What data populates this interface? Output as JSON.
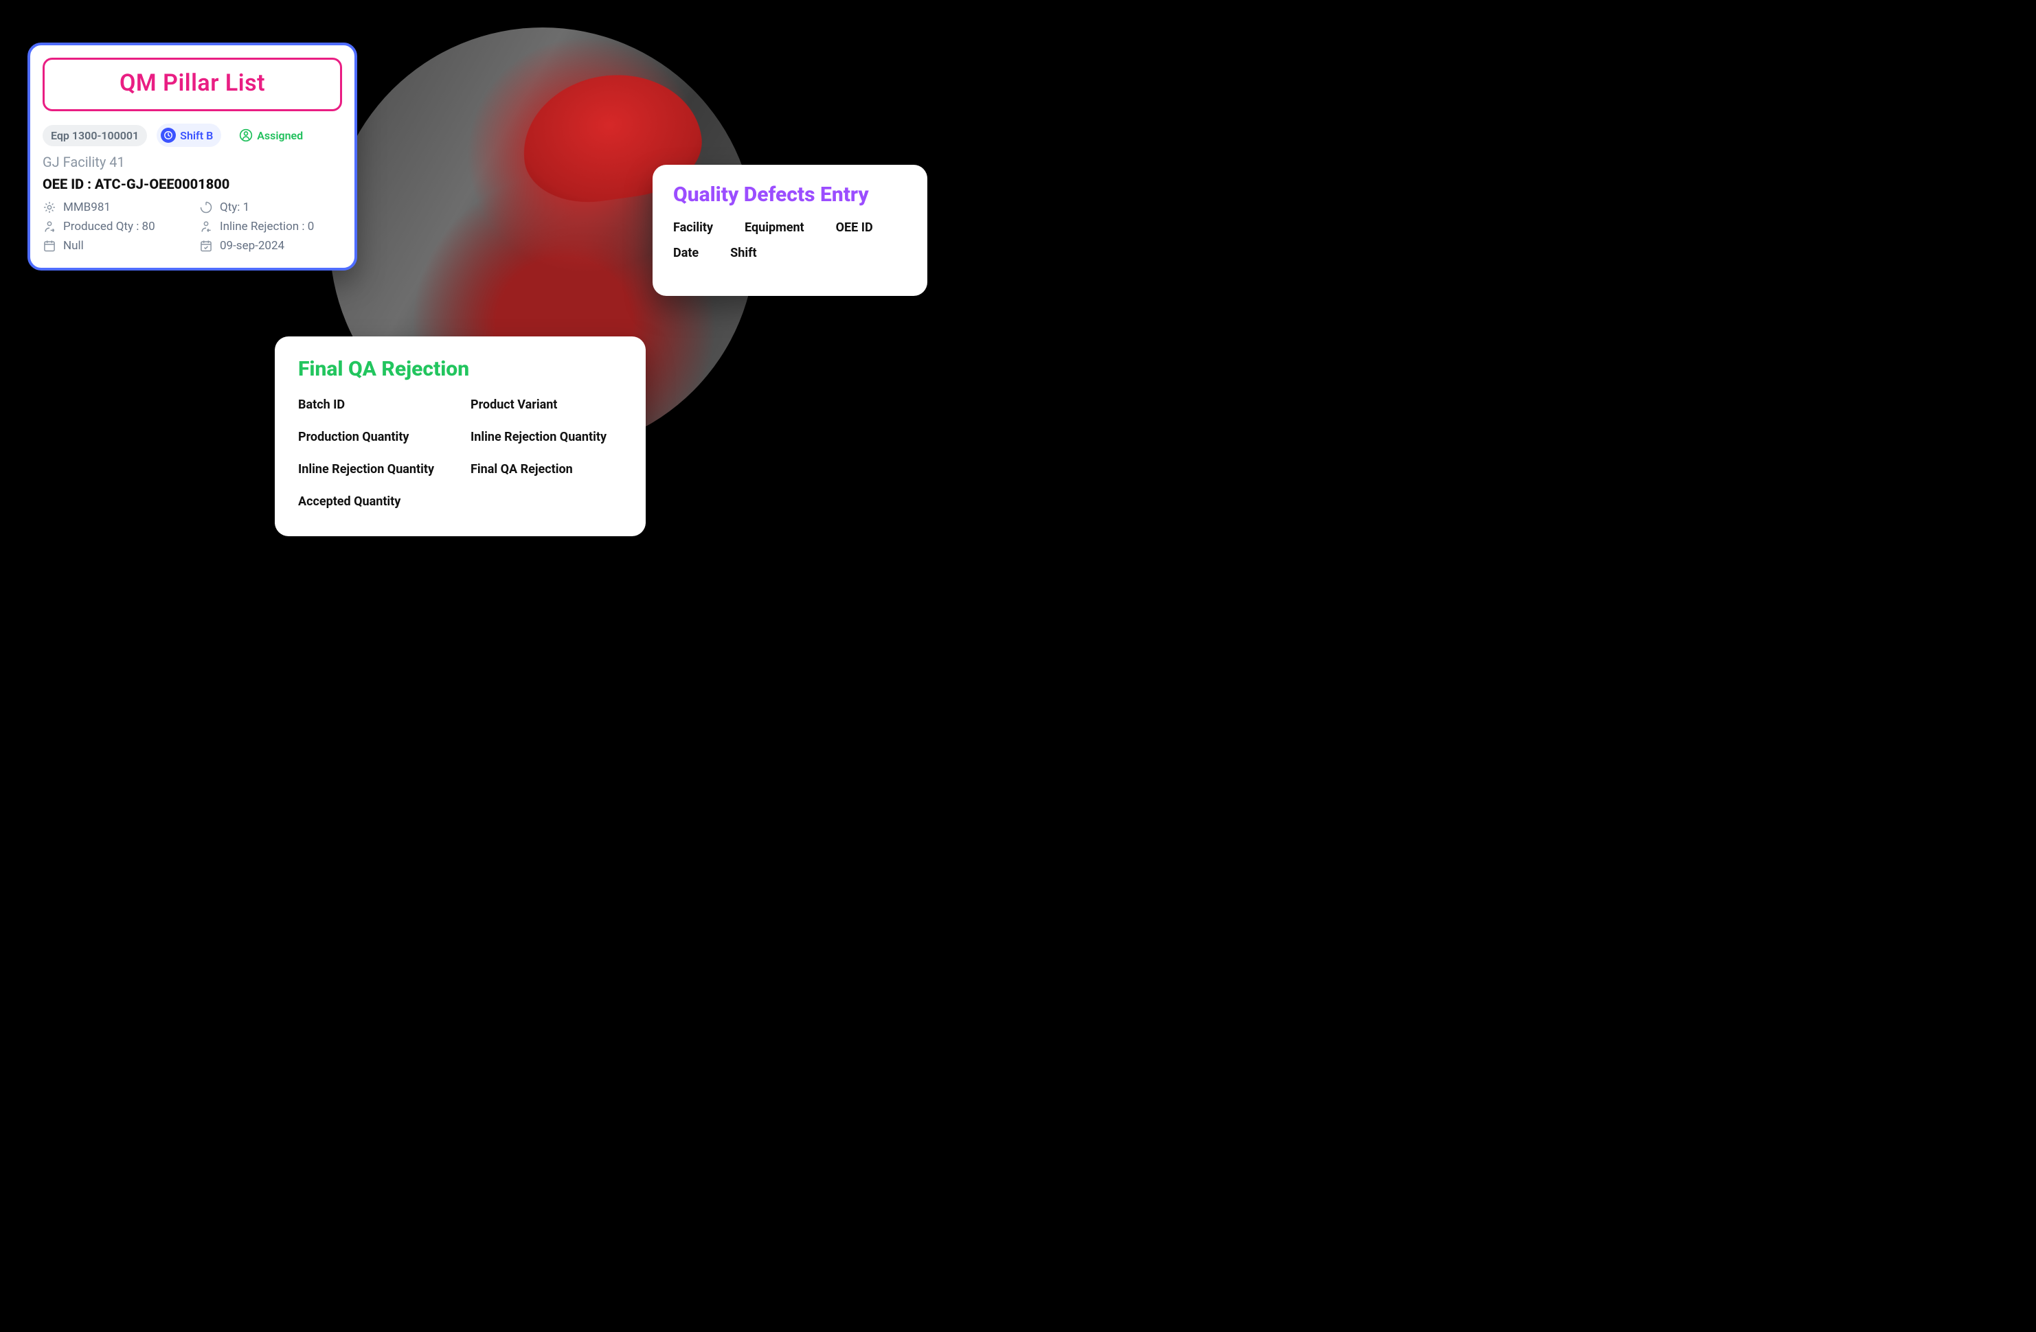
{
  "qm": {
    "title": "QM Pillar List",
    "chips": {
      "equipment": "Eqp 1300-100001",
      "shift": "Shift B",
      "status": "Assigned"
    },
    "facility": "GJ Facility 41",
    "oee_id_label": "OEE ID : ATC-GJ-OEE0001800",
    "details": {
      "product": "MMB981",
      "qty": "Qty: 1",
      "produced_qty": "Produced Qty : 80",
      "inline_rejection": "Inline Rejection : 0",
      "null_field": "Null",
      "date": "09-sep-2024"
    }
  },
  "qde": {
    "title": "Quality Defects Entry",
    "labels": {
      "facility": "Facility",
      "equipment": "Equipment",
      "oee_id": "OEE ID",
      "date": "Date",
      "shift": "Shift"
    }
  },
  "fqa": {
    "title": "Final QA Rejection",
    "labels": {
      "batch_id": "Batch ID",
      "product_variant": "Product Variant",
      "production_qty": "Production Quantity",
      "inline_rej_qty1": "Inline Rejection Quantity",
      "inline_rej_qty2": "Inline Rejection Quantity",
      "final_qa_rej": "Final QA Rejection",
      "accepted_qty": "Accepted Quantity"
    }
  }
}
